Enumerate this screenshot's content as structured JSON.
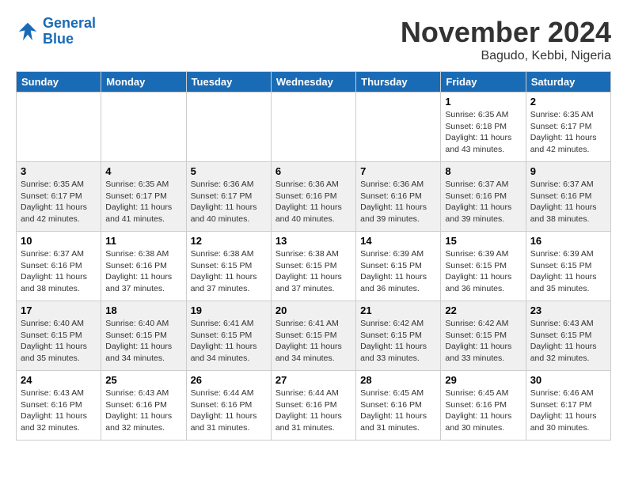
{
  "logo": {
    "line1": "General",
    "line2": "Blue"
  },
  "title": "November 2024",
  "subtitle": "Bagudo, Kebbi, Nigeria",
  "days_of_week": [
    "Sunday",
    "Monday",
    "Tuesday",
    "Wednesday",
    "Thursday",
    "Friday",
    "Saturday"
  ],
  "weeks": [
    [
      {
        "day": "",
        "info": ""
      },
      {
        "day": "",
        "info": ""
      },
      {
        "day": "",
        "info": ""
      },
      {
        "day": "",
        "info": ""
      },
      {
        "day": "",
        "info": ""
      },
      {
        "day": "1",
        "info": "Sunrise: 6:35 AM\nSunset: 6:18 PM\nDaylight: 11 hours and 43 minutes."
      },
      {
        "day": "2",
        "info": "Sunrise: 6:35 AM\nSunset: 6:17 PM\nDaylight: 11 hours and 42 minutes."
      }
    ],
    [
      {
        "day": "3",
        "info": "Sunrise: 6:35 AM\nSunset: 6:17 PM\nDaylight: 11 hours and 42 minutes."
      },
      {
        "day": "4",
        "info": "Sunrise: 6:35 AM\nSunset: 6:17 PM\nDaylight: 11 hours and 41 minutes."
      },
      {
        "day": "5",
        "info": "Sunrise: 6:36 AM\nSunset: 6:17 PM\nDaylight: 11 hours and 40 minutes."
      },
      {
        "day": "6",
        "info": "Sunrise: 6:36 AM\nSunset: 6:16 PM\nDaylight: 11 hours and 40 minutes."
      },
      {
        "day": "7",
        "info": "Sunrise: 6:36 AM\nSunset: 6:16 PM\nDaylight: 11 hours and 39 minutes."
      },
      {
        "day": "8",
        "info": "Sunrise: 6:37 AM\nSunset: 6:16 PM\nDaylight: 11 hours and 39 minutes."
      },
      {
        "day": "9",
        "info": "Sunrise: 6:37 AM\nSunset: 6:16 PM\nDaylight: 11 hours and 38 minutes."
      }
    ],
    [
      {
        "day": "10",
        "info": "Sunrise: 6:37 AM\nSunset: 6:16 PM\nDaylight: 11 hours and 38 minutes."
      },
      {
        "day": "11",
        "info": "Sunrise: 6:38 AM\nSunset: 6:16 PM\nDaylight: 11 hours and 37 minutes."
      },
      {
        "day": "12",
        "info": "Sunrise: 6:38 AM\nSunset: 6:15 PM\nDaylight: 11 hours and 37 minutes."
      },
      {
        "day": "13",
        "info": "Sunrise: 6:38 AM\nSunset: 6:15 PM\nDaylight: 11 hours and 37 minutes."
      },
      {
        "day": "14",
        "info": "Sunrise: 6:39 AM\nSunset: 6:15 PM\nDaylight: 11 hours and 36 minutes."
      },
      {
        "day": "15",
        "info": "Sunrise: 6:39 AM\nSunset: 6:15 PM\nDaylight: 11 hours and 36 minutes."
      },
      {
        "day": "16",
        "info": "Sunrise: 6:39 AM\nSunset: 6:15 PM\nDaylight: 11 hours and 35 minutes."
      }
    ],
    [
      {
        "day": "17",
        "info": "Sunrise: 6:40 AM\nSunset: 6:15 PM\nDaylight: 11 hours and 35 minutes."
      },
      {
        "day": "18",
        "info": "Sunrise: 6:40 AM\nSunset: 6:15 PM\nDaylight: 11 hours and 34 minutes."
      },
      {
        "day": "19",
        "info": "Sunrise: 6:41 AM\nSunset: 6:15 PM\nDaylight: 11 hours and 34 minutes."
      },
      {
        "day": "20",
        "info": "Sunrise: 6:41 AM\nSunset: 6:15 PM\nDaylight: 11 hours and 34 minutes."
      },
      {
        "day": "21",
        "info": "Sunrise: 6:42 AM\nSunset: 6:15 PM\nDaylight: 11 hours and 33 minutes."
      },
      {
        "day": "22",
        "info": "Sunrise: 6:42 AM\nSunset: 6:15 PM\nDaylight: 11 hours and 33 minutes."
      },
      {
        "day": "23",
        "info": "Sunrise: 6:43 AM\nSunset: 6:15 PM\nDaylight: 11 hours and 32 minutes."
      }
    ],
    [
      {
        "day": "24",
        "info": "Sunrise: 6:43 AM\nSunset: 6:16 PM\nDaylight: 11 hours and 32 minutes."
      },
      {
        "day": "25",
        "info": "Sunrise: 6:43 AM\nSunset: 6:16 PM\nDaylight: 11 hours and 32 minutes."
      },
      {
        "day": "26",
        "info": "Sunrise: 6:44 AM\nSunset: 6:16 PM\nDaylight: 11 hours and 31 minutes."
      },
      {
        "day": "27",
        "info": "Sunrise: 6:44 AM\nSunset: 6:16 PM\nDaylight: 11 hours and 31 minutes."
      },
      {
        "day": "28",
        "info": "Sunrise: 6:45 AM\nSunset: 6:16 PM\nDaylight: 11 hours and 31 minutes."
      },
      {
        "day": "29",
        "info": "Sunrise: 6:45 AM\nSunset: 6:16 PM\nDaylight: 11 hours and 30 minutes."
      },
      {
        "day": "30",
        "info": "Sunrise: 6:46 AM\nSunset: 6:17 PM\nDaylight: 11 hours and 30 minutes."
      }
    ]
  ]
}
